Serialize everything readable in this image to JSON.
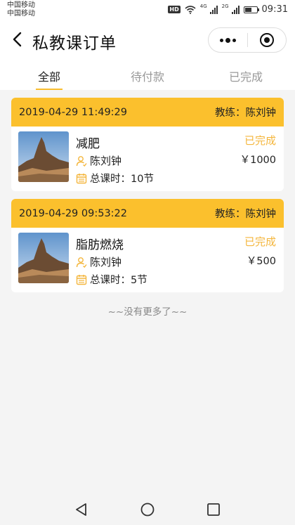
{
  "status_bar": {
    "carrier_1": "中国移动",
    "carrier_2": "中国移动",
    "hd_label": "HD",
    "net_label_1": "4G",
    "net_label_2": "2G",
    "time": "09:31",
    "icons": [
      "wifi-icon",
      "signal-icon",
      "battery-icon"
    ]
  },
  "navbar": {
    "title": "私教课订单",
    "icons": [
      "back-icon",
      "more-icon",
      "close-icon"
    ]
  },
  "tabs": [
    {
      "label": "全部",
      "active": true
    },
    {
      "label": "待付款",
      "active": false
    },
    {
      "label": "已完成",
      "active": false
    }
  ],
  "orders": [
    {
      "datetime": "2019-04-29 11:49:29",
      "coach_header": "教练：陈刘钟",
      "course": "减肥",
      "coach": "陈刘钟",
      "hours": "总课时：10节",
      "status": "已完成",
      "price": "￥1000"
    },
    {
      "datetime": "2019-04-29 09:53:22",
      "coach_header": "教练：陈刘钟",
      "course": "脂肪燃烧",
      "coach": "陈刘钟",
      "hours": "总课时：5节",
      "status": "已完成",
      "price": "￥500"
    }
  ],
  "footer_text": "~~没有更多了~~",
  "colors": {
    "accent": "#fbc02d",
    "status": "#f4b63d",
    "background": "#f4f4f4"
  },
  "system_nav": [
    "back-triangle-icon",
    "home-circle-icon",
    "recents-square-icon"
  ]
}
